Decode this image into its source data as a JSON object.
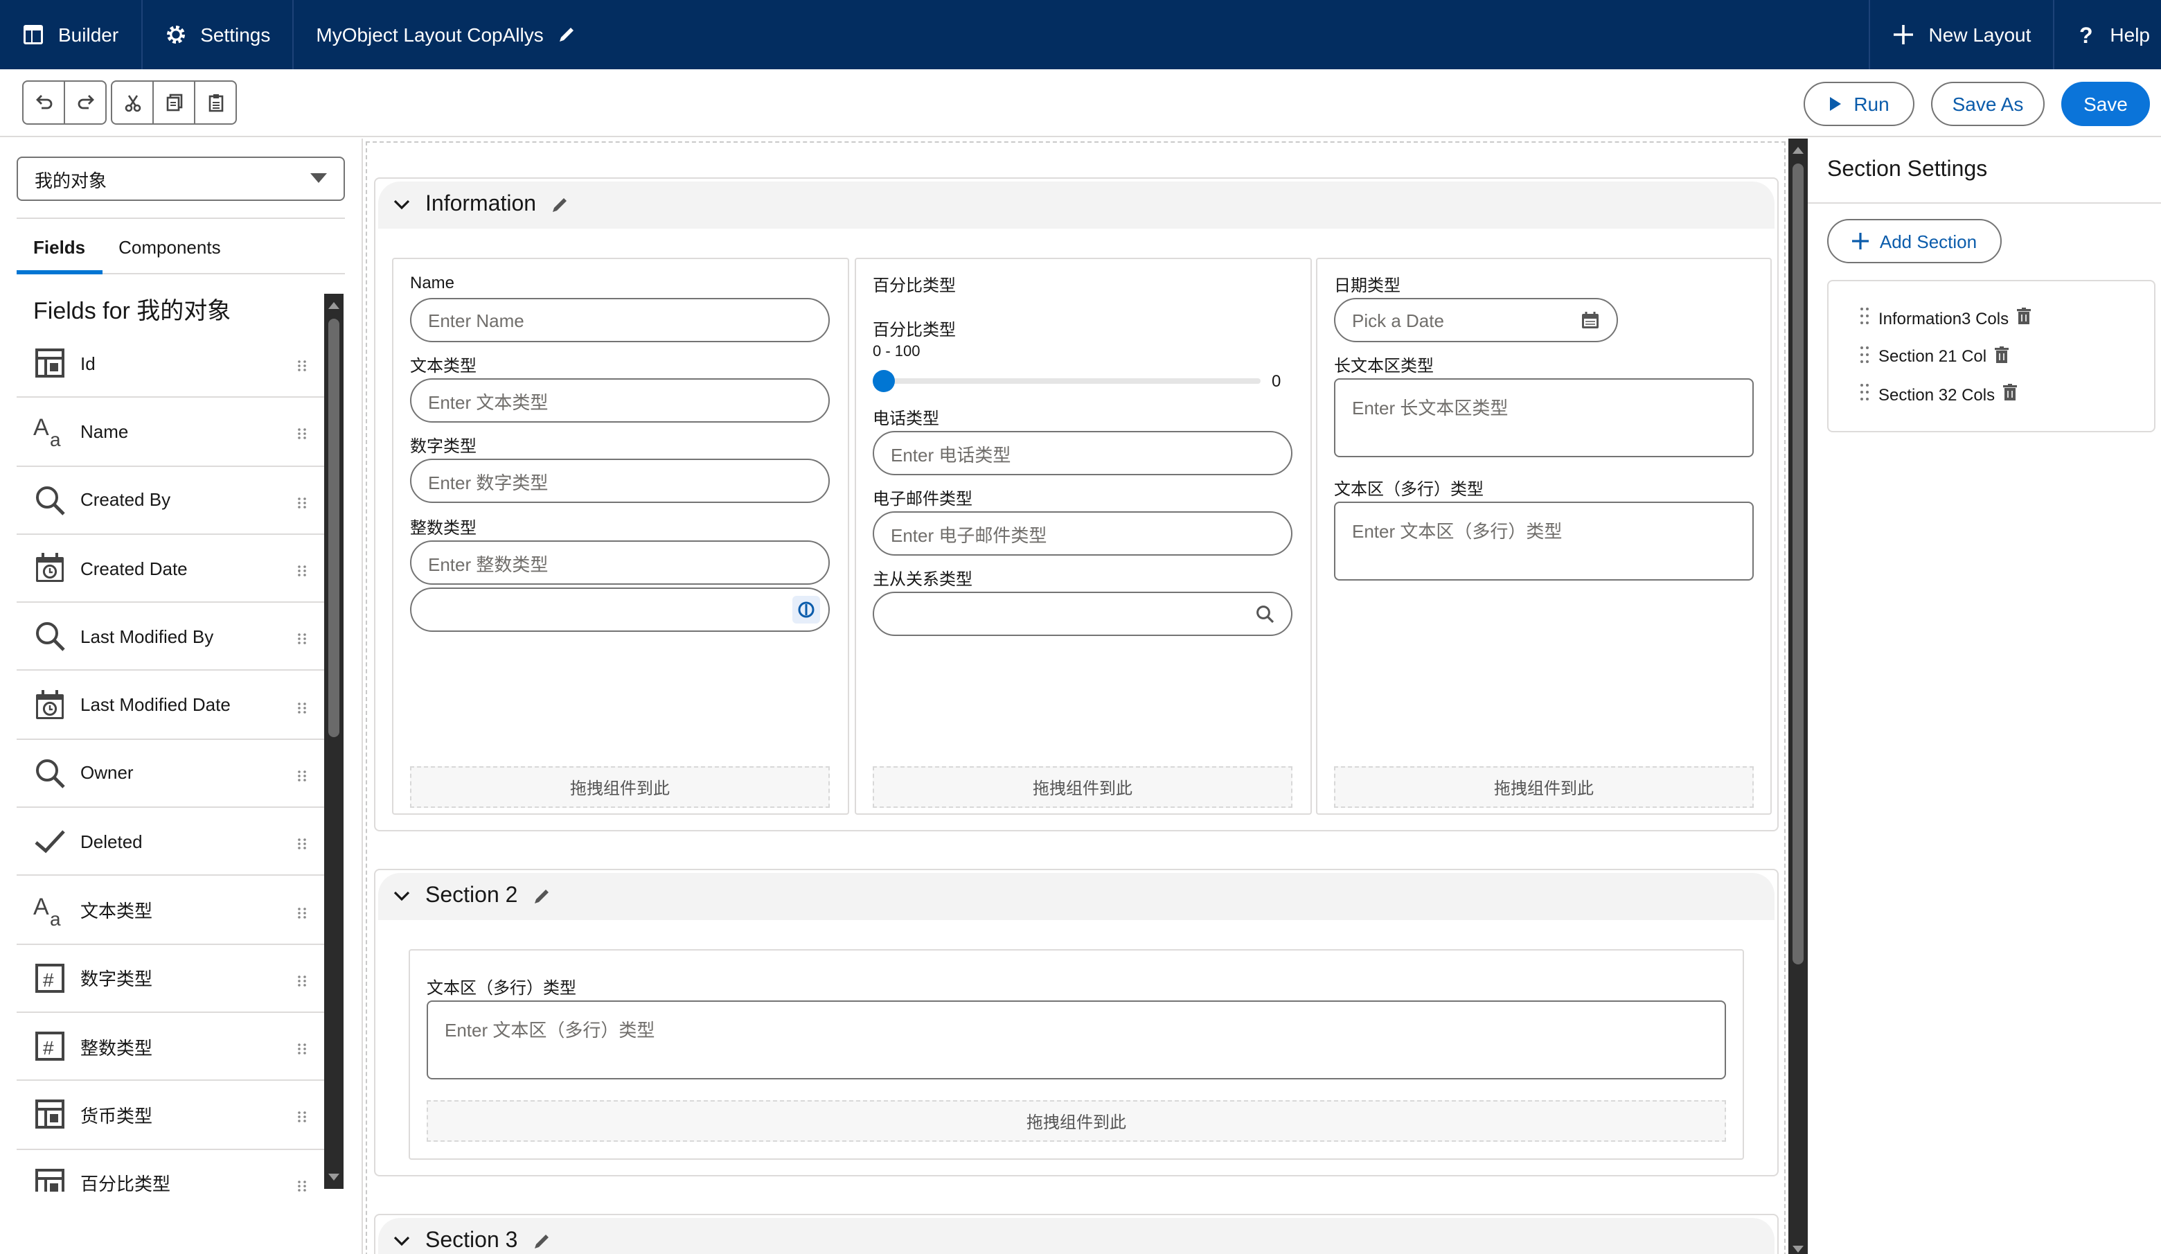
{
  "topbar": {
    "builder": "Builder",
    "settings": "Settings",
    "layout_name": "MyObject Layout CopAllys",
    "new_layout": "New Layout",
    "help": "Help"
  },
  "toolbar": {
    "run": "Run",
    "save_as": "Save As",
    "save": "Save"
  },
  "left": {
    "object_select": "我的对象",
    "tabs": [
      "Fields",
      "Components"
    ],
    "fields_heading": "Fields for 我的对象",
    "fields": [
      {
        "label": "Id",
        "icon": "table-icon"
      },
      {
        "label": "Name",
        "icon": "text-type-icon"
      },
      {
        "label": "Created By",
        "icon": "search-icon"
      },
      {
        "label": "Created Date",
        "icon": "calendar-clock-icon"
      },
      {
        "label": "Last Modified By",
        "icon": "search-icon"
      },
      {
        "label": "Last Modified Date",
        "icon": "calendar-clock-icon"
      },
      {
        "label": "Owner",
        "icon": "search-icon"
      },
      {
        "label": "Deleted",
        "icon": "check-icon"
      },
      {
        "label": "文本类型",
        "icon": "text-type-icon"
      },
      {
        "label": "数字类型",
        "icon": "number-icon"
      },
      {
        "label": "整数类型",
        "icon": "number-icon"
      },
      {
        "label": "货币类型",
        "icon": "table-icon"
      },
      {
        "label": "百分比类型",
        "icon": "table-icon"
      }
    ]
  },
  "sections": {
    "information": {
      "title": "Information",
      "col1": {
        "name_label": "Name",
        "name_ph": "Enter Name",
        "text_label": "文本类型",
        "text_ph": "Enter 文本类型",
        "number_label": "数字类型",
        "number_ph": "Enter 数字类型",
        "int_label": "整数类型",
        "int_ph": "Enter 整数类型"
      },
      "col2": {
        "group_label": "百分比类型",
        "pct_label": "百分比类型",
        "range": "0 - 100",
        "slider_value": "0",
        "phone_label": "电话类型",
        "phone_ph": "Enter 电话类型",
        "email_label": "电子邮件类型",
        "email_ph": "Enter 电子邮件类型",
        "master_label": "主从关系类型"
      },
      "col3": {
        "date_label": "日期类型",
        "date_ph": "Pick a Date",
        "longtext_label": "长文本区类型",
        "longtext_ph": "Enter 长文本区类型",
        "textarea_label": "文本区（多行）类型",
        "textarea_ph": "Enter 文本区（多行）类型"
      },
      "dropzone": "拖拽组件到此"
    },
    "section2": {
      "title": "Section 2",
      "textarea_label": "文本区（多行）类型",
      "textarea_ph": "Enter 文本区（多行）类型",
      "dropzone": "拖拽组件到此"
    },
    "section3": {
      "title": "Section 3"
    }
  },
  "right": {
    "title": "Section Settings",
    "add_section": "Add Section",
    "items": [
      "Information3 Cols",
      "Section 21 Col",
      "Section 32 Cols"
    ]
  },
  "colors": {
    "topbar": "#032d60",
    "brand": "#0b74d9",
    "link": "#0b5cab",
    "slider": "#0176d3"
  }
}
